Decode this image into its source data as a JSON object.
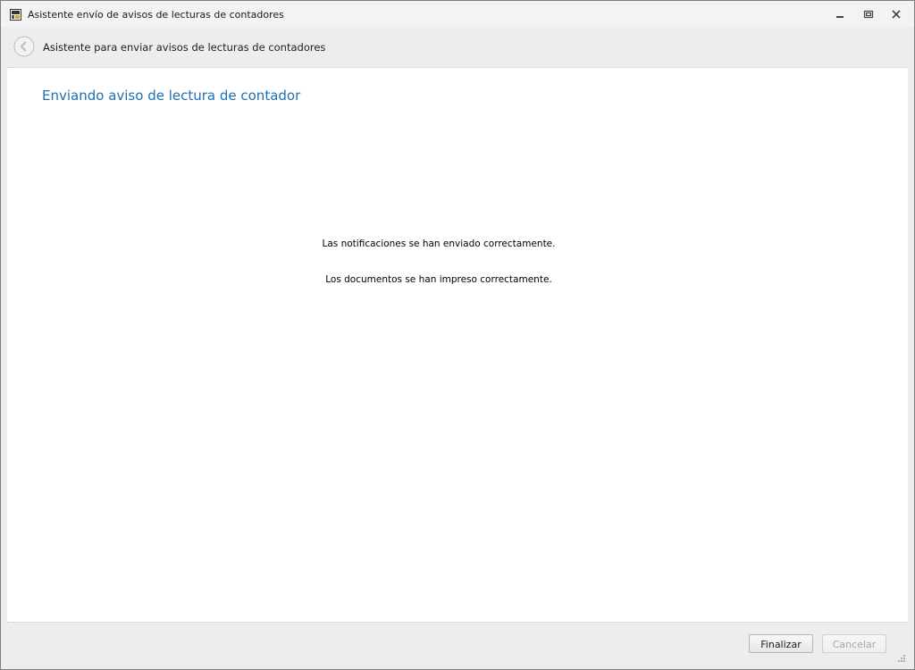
{
  "window": {
    "title": "Asistente envío de avisos de lecturas de contadores",
    "controls": {
      "minimize_icon": "minimize-icon",
      "restore_icon": "restore-icon",
      "close_icon": "close-icon"
    }
  },
  "header": {
    "back_icon": "back-arrow-icon",
    "title": "Asistente para enviar avisos de lecturas de contadores"
  },
  "content": {
    "page_title": "Enviando aviso de lectura de contador",
    "messages": [
      "Las notificaciones se han enviado correctamente.",
      "Los documentos se han impreso correctamente."
    ]
  },
  "footer": {
    "finish_label": "Finalizar",
    "cancel_label": "Cancelar",
    "cancel_enabled": false
  },
  "colors": {
    "page_title": "#1f6fb2",
    "header_background": "#ebedef",
    "content_background": "#ffffff"
  }
}
